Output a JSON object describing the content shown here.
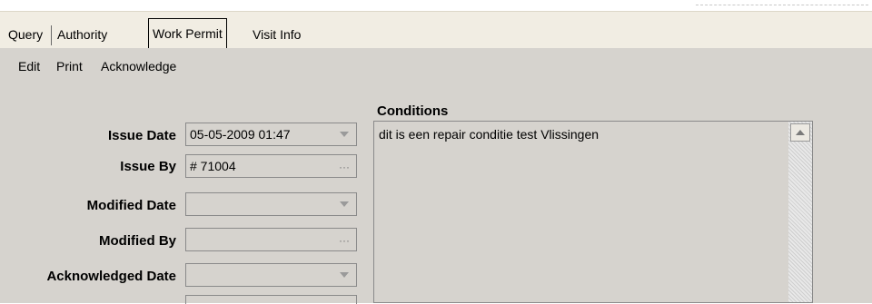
{
  "tabs": [
    "Query",
    "Authority",
    "Work Permit",
    "Visit Info"
  ],
  "active_tab": "Work Permit",
  "menu": [
    "Edit",
    "Print",
    "Acknowledge"
  ],
  "fields": [
    {
      "label": "Issue Date",
      "value": "05-05-2009 01:47",
      "control": "dropdown"
    },
    {
      "label": "Issue By",
      "value": "# 71004",
      "control": "ellipsis"
    },
    {
      "label": "Modified Date",
      "value": "",
      "control": "dropdown"
    },
    {
      "label": "Modified By",
      "value": "",
      "control": "ellipsis"
    },
    {
      "label": "Acknowledged Date",
      "value": "",
      "control": "dropdown"
    }
  ],
  "conditions": {
    "title": "Conditions",
    "text": "dit is een repair conditie test Vlissingen"
  },
  "icons": {
    "dropdown": "chevron-down-icon",
    "ellipsis": "ellipsis-icon",
    "scroll_up": "scroll-up-arrow-icon"
  },
  "ellipsis_glyph": "···",
  "colors": {
    "panel": "#d6d3ce",
    "tabbar": "#f1ede3"
  }
}
